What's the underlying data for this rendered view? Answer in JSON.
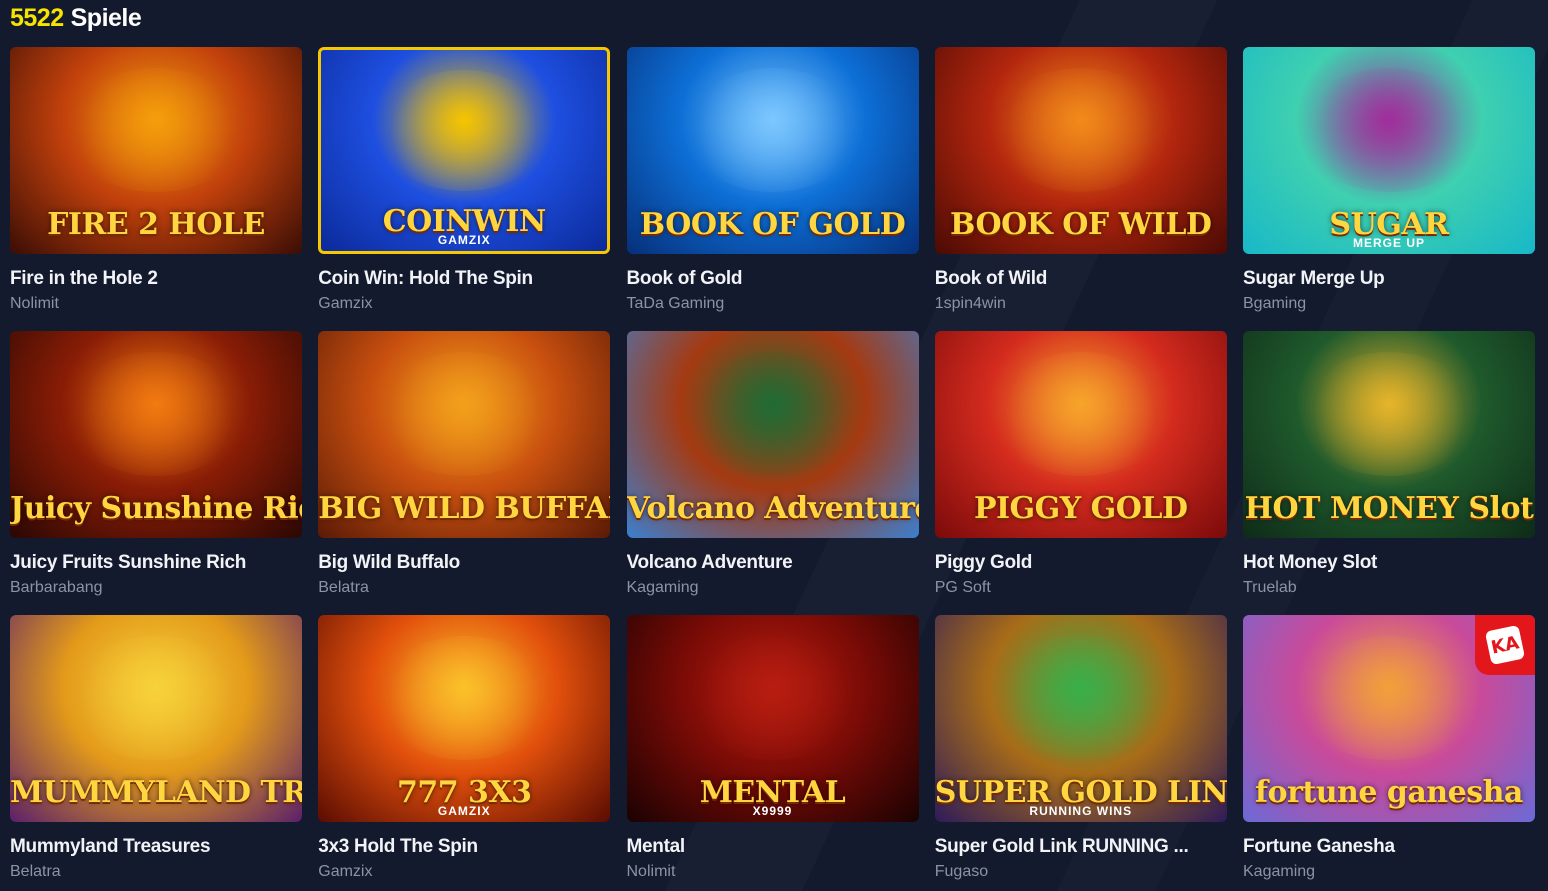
{
  "header": {
    "count": "5522",
    "label": "Spiele"
  },
  "games": [
    {
      "name": "Fire in the Hole 2",
      "provider": "Nolimit",
      "art_title": "FIRE 2 HOLE",
      "art_sub": "",
      "bg": [
        "#3a0d05",
        "#c2410c",
        "#f59e0b"
      ]
    },
    {
      "name": "Coin Win: Hold The Spin",
      "provider": "Gamzix",
      "art_title": "COINWIN",
      "art_sub": "GAMZIX",
      "bg": [
        "#0b2a9a",
        "#1e4fe0",
        "#f6c400"
      ],
      "selected": true
    },
    {
      "name": "Book of Gold",
      "provider": "TaDa Gaming",
      "art_title": "BOOK OF GOLD",
      "art_sub": "",
      "bg": [
        "#062f7a",
        "#0d6fd6",
        "#7cc7ff"
      ]
    },
    {
      "name": "Book of Wild",
      "provider": "1spin4win",
      "art_title": "BOOK OF WILD",
      "art_sub": "",
      "bg": [
        "#4a0a04",
        "#b3260e",
        "#f28a1a"
      ]
    },
    {
      "name": "Sugar Merge Up",
      "provider": "Bgaming",
      "art_title": "SUGAR",
      "art_sub": "MERGE UP",
      "bg": [
        "#17b8c8",
        "#3fd0b0",
        "#a12d9b"
      ]
    },
    {
      "name": "Juicy Fruits Sunshine Rich",
      "provider": "Barbarabang",
      "art_title": "Juicy Sunshine Rich",
      "art_sub": "",
      "bg": [
        "#2a0703",
        "#8a1d06",
        "#f27a10"
      ]
    },
    {
      "name": "Big Wild Buffalo",
      "provider": "Belatra",
      "art_title": "BIG WILD BUFFALO",
      "art_sub": "",
      "bg": [
        "#5a1a06",
        "#c9500f",
        "#f3a01b"
      ]
    },
    {
      "name": "Volcano Adventure",
      "provider": "Kagaming",
      "art_title": "Volcano Adventure",
      "art_sub": "",
      "bg": [
        "#3b7fd0",
        "#a53a12",
        "#1f6b33"
      ]
    },
    {
      "name": "Piggy Gold",
      "provider": "PG Soft",
      "art_title": "PIGGY GOLD",
      "art_sub": "",
      "bg": [
        "#7a0a0a",
        "#d42b1e",
        "#f7a52b"
      ]
    },
    {
      "name": "Hot Money Slot",
      "provider": "Truelab",
      "art_title": "HOT MONEY Slot",
      "art_sub": "",
      "bg": [
        "#0e2b18",
        "#1f5a2c",
        "#e6b42a"
      ]
    },
    {
      "name": "Mummyland Treasures",
      "provider": "Belatra",
      "art_title": "MUMMYLAND TREASURES",
      "art_sub": "",
      "bg": [
        "#5a1f6b",
        "#e39a1a",
        "#f7d23a"
      ]
    },
    {
      "name": "3x3 Hold The Spin",
      "provider": "Gamzix",
      "art_title": "777 3X3",
      "art_sub": "GAMZIX",
      "bg": [
        "#5a0c02",
        "#e2500c",
        "#fbc12a"
      ]
    },
    {
      "name": "Mental",
      "provider": "Nolimit",
      "art_title": "MENTAL",
      "art_sub": "X9999",
      "bg": [
        "#1a0202",
        "#7a0b06",
        "#b81d10"
      ]
    },
    {
      "name": "Super Gold Link RUNNING ...",
      "provider": "Fugaso",
      "art_title": "SUPER GOLD LINK",
      "art_sub": "RUNNING WINS",
      "bg": [
        "#2d1a5a",
        "#a86c18",
        "#38b04a"
      ]
    },
    {
      "name": "Fortune Ganesha",
      "provider": "Kagaming",
      "art_title": "fortune ganesha",
      "art_sub": "",
      "bg": [
        "#6b6ad6",
        "#c94a9a",
        "#f2a03a"
      ],
      "badge": "KA"
    }
  ]
}
